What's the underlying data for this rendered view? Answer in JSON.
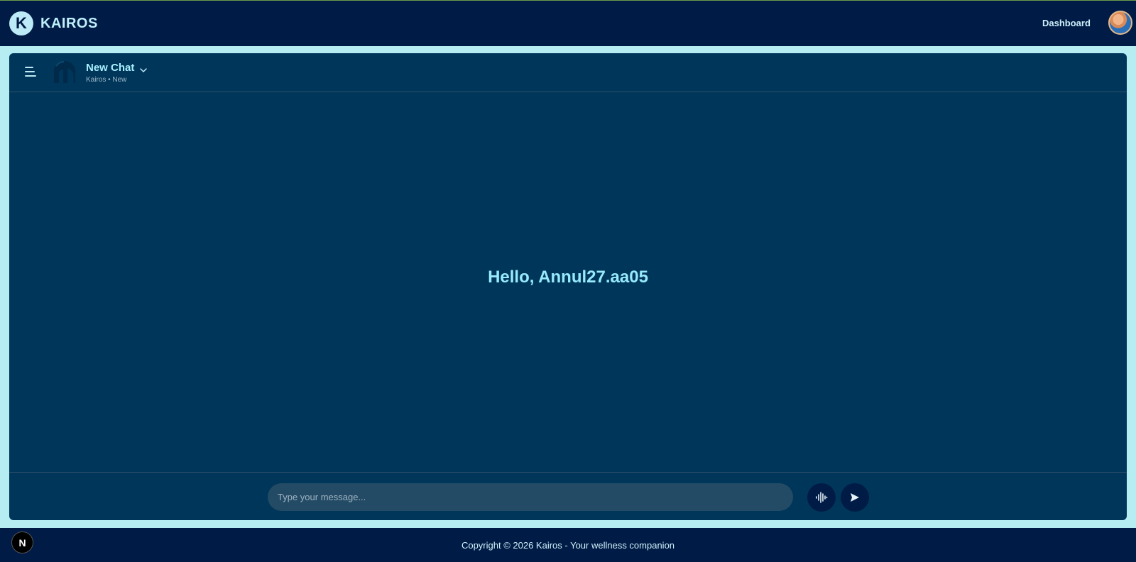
{
  "header": {
    "logo_letter": "K",
    "brand_name": "KAIROS",
    "nav_dashboard": "Dashboard"
  },
  "chat": {
    "title": "New Chat",
    "subtitle": "Kairos • New",
    "greeting": "Hello, Annul27.aa05"
  },
  "composer": {
    "placeholder": "Type your message..."
  },
  "footer": {
    "copyright": "Copyright © 2026 Kairos - Your wellness companion",
    "badge_letter": "N"
  },
  "icons": {
    "menu": "hamburger-menu-icon",
    "helmet": "spartan-helmet-icon",
    "chevron": "chevron-down-icon",
    "voice": "waveform-icon",
    "send": "send-icon"
  },
  "colors": {
    "topbar": "#001B45",
    "page_background": "#B5EDF2",
    "panel": "#00365A",
    "accent_text": "#97EAFB",
    "input": "#244B65"
  }
}
